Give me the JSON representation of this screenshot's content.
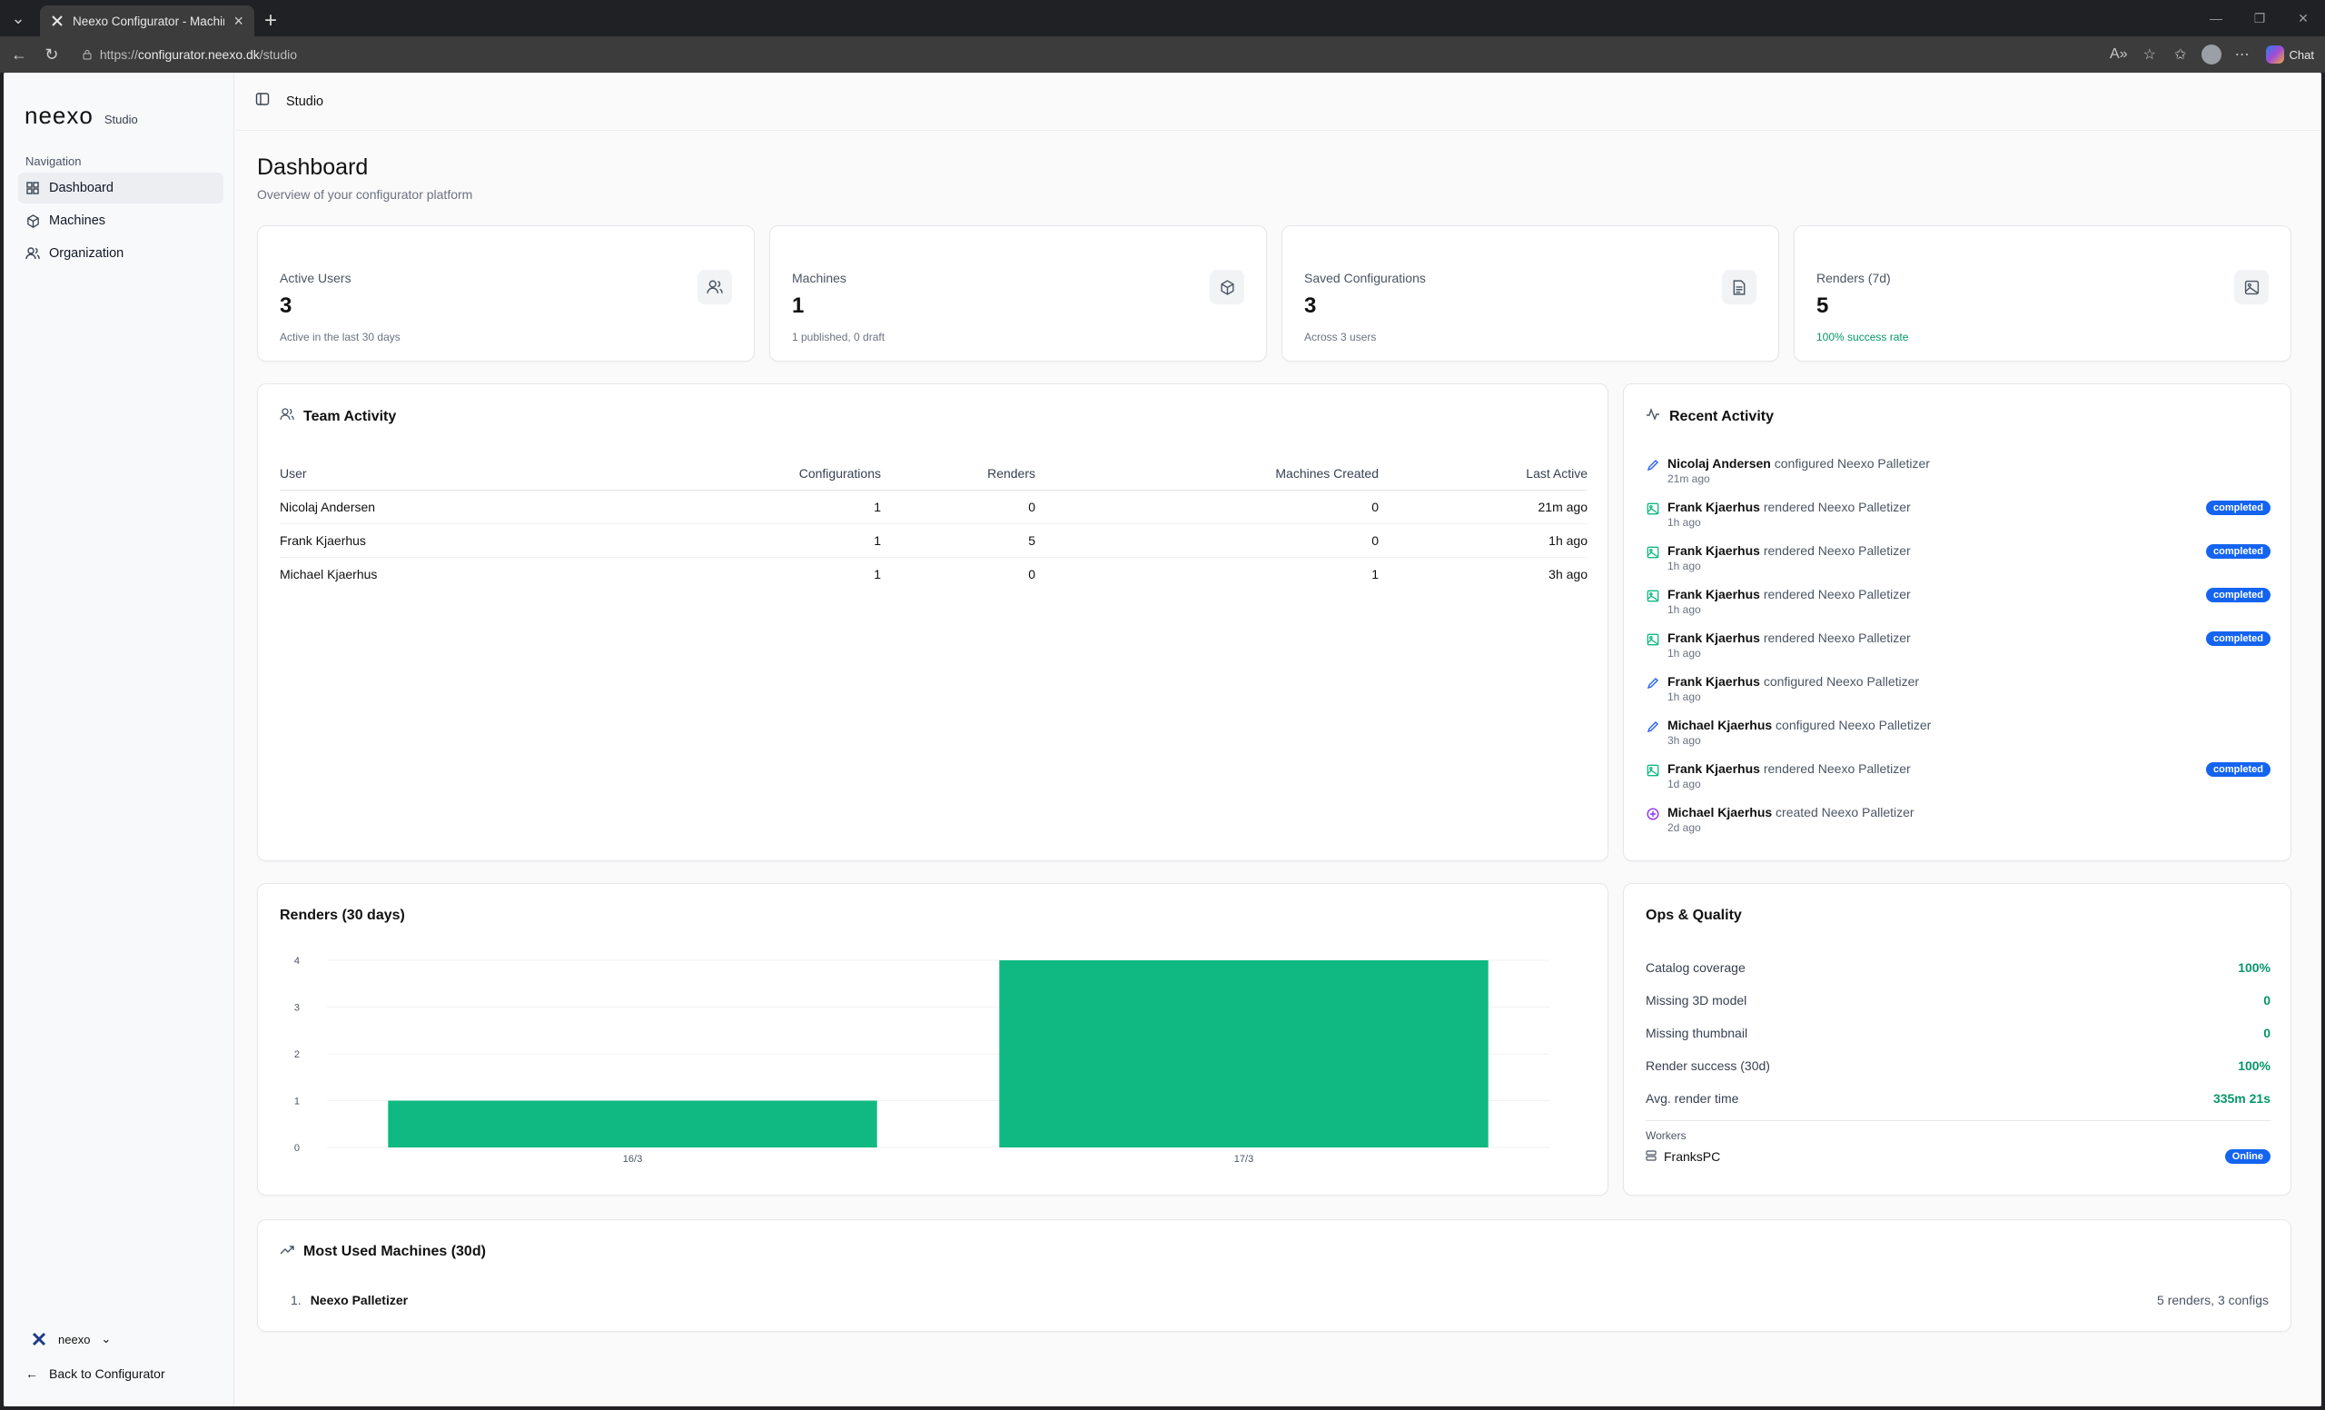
{
  "browser": {
    "tab_title": "Neexo Configurator - Machine Co",
    "url_scheme": "https://",
    "url_host": "configurator.neexo.dk",
    "url_path": "/studio",
    "chat_label": "Chat"
  },
  "sidebar": {
    "brand": "neexo",
    "brand_sub": "Studio",
    "nav_label": "Navigation",
    "items": [
      {
        "label": "Dashboard",
        "icon": "grid-icon",
        "active": true
      },
      {
        "label": "Machines",
        "icon": "box-icon"
      },
      {
        "label": "Organization",
        "icon": "users-icon"
      }
    ],
    "org": "neexo",
    "back_label": "Back to Configurator"
  },
  "topbar": {
    "crumb": "Studio"
  },
  "page": {
    "title": "Dashboard",
    "subtitle": "Overview of your configurator platform"
  },
  "stats": [
    {
      "label": "Active Users",
      "value": "3",
      "sub": "Active in the last 30 days",
      "icon": "users-icon"
    },
    {
      "label": "Machines",
      "value": "1",
      "sub": "1 published, 0 draft",
      "icon": "box-icon"
    },
    {
      "label": "Saved Configurations",
      "value": "3",
      "sub": "Across 3 users",
      "icon": "document-icon"
    },
    {
      "label": "Renders (7d)",
      "value": "5",
      "sub": "100% success rate",
      "icon": "image-icon",
      "sub_color": "#059669"
    }
  ],
  "team": {
    "title": "Team Activity",
    "columns": [
      "User",
      "Configurations",
      "Renders",
      "Machines Created",
      "Last Active"
    ],
    "rows": [
      [
        "Nicolaj Andersen",
        "1",
        "0",
        "0",
        "21m ago"
      ],
      [
        "Frank Kjaerhus",
        "1",
        "5",
        "0",
        "1h ago"
      ],
      [
        "Michael Kjaerhus",
        "1",
        "0",
        "1",
        "3h ago"
      ]
    ]
  },
  "recent": {
    "title": "Recent Activity",
    "items": [
      {
        "user": "Nicolaj Andersen",
        "action": "configured",
        "target": "Neexo Palletizer",
        "time": "21m ago",
        "kind": "configure"
      },
      {
        "user": "Frank Kjaerhus",
        "action": "rendered",
        "target": "Neexo Palletizer",
        "time": "1h ago",
        "kind": "render",
        "badge": "completed"
      },
      {
        "user": "Frank Kjaerhus",
        "action": "rendered",
        "target": "Neexo Palletizer",
        "time": "1h ago",
        "kind": "render",
        "badge": "completed"
      },
      {
        "user": "Frank Kjaerhus",
        "action": "rendered",
        "target": "Neexo Palletizer",
        "time": "1h ago",
        "kind": "render",
        "badge": "completed"
      },
      {
        "user": "Frank Kjaerhus",
        "action": "rendered",
        "target": "Neexo Palletizer",
        "time": "1h ago",
        "kind": "render",
        "badge": "completed"
      },
      {
        "user": "Frank Kjaerhus",
        "action": "configured",
        "target": "Neexo Palletizer",
        "time": "1h ago",
        "kind": "configure"
      },
      {
        "user": "Michael Kjaerhus",
        "action": "configured",
        "target": "Neexo Palletizer",
        "time": "3h ago",
        "kind": "configure"
      },
      {
        "user": "Frank Kjaerhus",
        "action": "rendered",
        "target": "Neexo Palletizer",
        "time": "1d ago",
        "kind": "render",
        "badge": "completed"
      },
      {
        "user": "Michael Kjaerhus",
        "action": "created",
        "target": "Neexo Palletizer",
        "time": "2d ago",
        "kind": "create"
      }
    ]
  },
  "renders_chart": {
    "title": "Renders (30 days)"
  },
  "chart_data": {
    "type": "bar",
    "categories": [
      "16/3",
      "17/3"
    ],
    "values": [
      1,
      4
    ],
    "ylim": [
      0,
      4
    ],
    "yticks": [
      0,
      1,
      2,
      3,
      4
    ],
    "color": "#10b981",
    "title": "Renders (30 days)",
    "xlabel": "",
    "ylabel": ""
  },
  "ops": {
    "title": "Ops & Quality",
    "rows": [
      {
        "label": "Catalog coverage",
        "value": "100%"
      },
      {
        "label": "Missing 3D model",
        "value": "0"
      },
      {
        "label": "Missing thumbnail",
        "value": "0"
      },
      {
        "label": "Render success (30d)",
        "value": "100%"
      },
      {
        "label": "Avg. render time",
        "value": "335m 21s"
      }
    ],
    "workers_label": "Workers",
    "workers": [
      {
        "name": "FranksPC",
        "status": "Online"
      }
    ]
  },
  "most_used": {
    "title": "Most Used Machines (30d)",
    "items": [
      {
        "rank": "1.",
        "name": "Neexo Palletizer",
        "stats": "5 renders, 3 configs"
      }
    ]
  },
  "colors": {
    "accent_green": "#10b981",
    "badge_blue": "#1464f0",
    "positive_text": "#059669"
  }
}
